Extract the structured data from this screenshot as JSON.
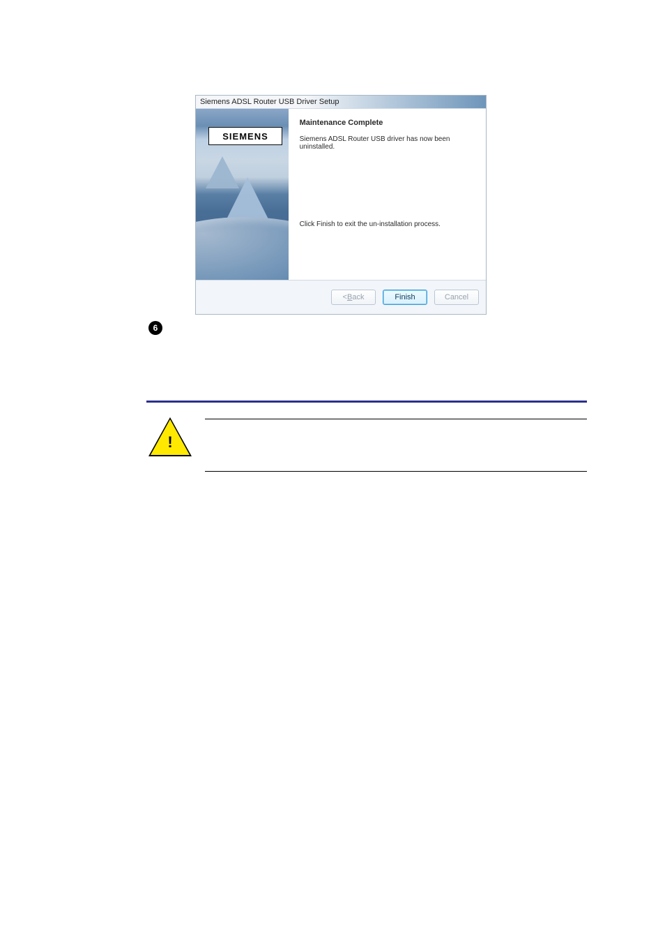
{
  "dialog": {
    "title": "Siemens ADSL Router USB Driver Setup",
    "logo": "SIEMENS",
    "heading": "Maintenance Complete",
    "line1": "Siemens ADSL Router USB driver has now been uninstalled.",
    "line2": "Click Finish to exit the un-installation process.",
    "buttons": {
      "back_prefix": "< ",
      "back_u": "B",
      "back_suffix": "ack",
      "finish": "Finish",
      "cancel": "Cancel"
    }
  },
  "step": {
    "number": "6"
  },
  "warning": {
    "mark": "!"
  }
}
